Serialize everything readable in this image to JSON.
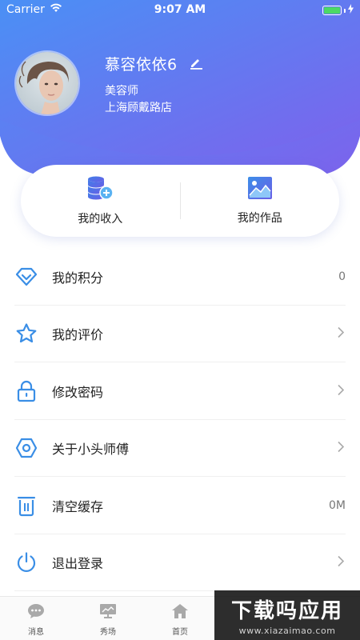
{
  "status_bar": {
    "carrier": "Carrier",
    "time": "9:07 AM"
  },
  "profile": {
    "name": "慕容依依6",
    "role": "美容师",
    "store": "上海顾戴路店"
  },
  "card": {
    "income_label": "我的收入",
    "works_label": "我的作品"
  },
  "menu": {
    "items": [
      {
        "label": "我的积分",
        "value": "0",
        "icon": "diamond-icon"
      },
      {
        "label": "我的评价",
        "value": "",
        "icon": "star-icon"
      },
      {
        "label": "修改密码",
        "value": "",
        "icon": "lock-icon"
      },
      {
        "label": "关于小头师傅",
        "value": "",
        "icon": "hexagon-icon"
      },
      {
        "label": "清空缓存",
        "value": "0M",
        "icon": "trash-icon"
      },
      {
        "label": "退出登录",
        "value": "",
        "icon": "power-icon"
      }
    ]
  },
  "tab_bar": {
    "tabs": [
      {
        "label": "消息",
        "icon": "chat-icon"
      },
      {
        "label": "秀场",
        "icon": "presentation-icon"
      },
      {
        "label": "首页",
        "icon": "home-icon"
      }
    ]
  },
  "watermark": {
    "title": "下载吗应用",
    "url": "www.xiazaimao.com"
  },
  "colors": {
    "gradient_start": "#4d8bf7",
    "gradient_end": "#7b68ee",
    "accent": "#3a8ee6"
  }
}
